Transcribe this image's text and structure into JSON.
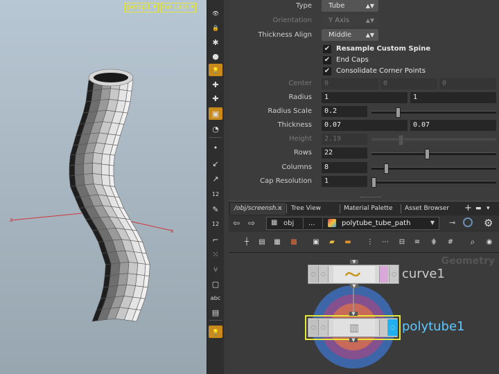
{
  "viewport": {
    "camera_menu": "persp1",
    "cam_menu": "no cam"
  },
  "shelf": {
    "items": [
      {
        "icon": "eye-icon",
        "glyph": "👁",
        "active": false
      },
      {
        "icon": "lock-icon",
        "glyph": "🔒",
        "active": false
      },
      {
        "icon": "snap-icon",
        "glyph": "✱",
        "active": false
      },
      {
        "icon": "sphere-icon",
        "glyph": "●",
        "active": false
      },
      {
        "icon": "light-bulb-icon",
        "glyph": "💡",
        "active": true
      },
      {
        "icon": "add-light-icon",
        "glyph": "✚",
        "active": false
      },
      {
        "icon": "ghost-light-icon",
        "glyph": "✚",
        "active": false
      },
      {
        "icon": "display-icon",
        "glyph": "▣",
        "active": true
      },
      {
        "icon": "visibility-icon",
        "glyph": "◔",
        "active": false
      },
      {
        "icon": "point-icon",
        "glyph": "•",
        "active": false
      },
      {
        "icon": "normal-icon",
        "glyph": "↙",
        "active": false
      },
      {
        "icon": "pick-icon",
        "glyph": "↗",
        "active": false
      },
      {
        "icon": "numbers-12-icon",
        "glyph": "12",
        "active": false
      },
      {
        "icon": "brush-icon",
        "glyph": "✎",
        "active": false
      },
      {
        "icon": "numbers-12b-icon",
        "glyph": "12",
        "active": false
      },
      {
        "icon": "corner-icon",
        "glyph": "⌐",
        "active": false
      },
      {
        "icon": "grid-dots-icon",
        "glyph": "⁙",
        "active": false
      },
      {
        "icon": "branch-icon",
        "glyph": "⑂",
        "active": false
      },
      {
        "icon": "frame-icon",
        "glyph": "▢",
        "active": false
      },
      {
        "icon": "text-abc-icon",
        "glyph": "abc",
        "active": false
      },
      {
        "icon": "image-icon",
        "glyph": "▤",
        "active": false
      },
      {
        "icon": "lamp-icon",
        "glyph": "💡",
        "active": true
      }
    ]
  },
  "params": {
    "type": {
      "label": "Type",
      "value": "Tube"
    },
    "orientation": {
      "label": "Orientation",
      "value": "Y Axis"
    },
    "thickness_align": {
      "label": "Thickness Align",
      "value": "Middle"
    },
    "resample": {
      "label": "Resample Custom Spine",
      "checked": true
    },
    "end_caps": {
      "label": "End Caps",
      "checked": true
    },
    "consolidate": {
      "label": "Consolidate Corner Points",
      "checked": true
    },
    "center": {
      "label": "Center",
      "values": [
        "0",
        "0",
        "0"
      ]
    },
    "radius": {
      "label": "Radius",
      "values": [
        "1",
        "1"
      ]
    },
    "radius_scale": {
      "label": "Radius Scale",
      "value": "0.2",
      "fraction": 0.2
    },
    "thickness": {
      "label": "Thickness",
      "values": [
        "0.07",
        "0.07"
      ]
    },
    "height": {
      "label": "Height",
      "value": "2.19",
      "fraction": 0.22
    },
    "rows": {
      "label": "Rows",
      "value": "22",
      "fraction": 0.44
    },
    "columns": {
      "label": "Columns",
      "value": "8",
      "fraction": 0.1
    },
    "cap_resolution": {
      "label": "Cap Resolution",
      "value": "1",
      "fraction": 0.0
    }
  },
  "tabs": {
    "items": [
      "/obj/screensh...",
      "Tree View",
      "Material Palette",
      "Asset Browser"
    ]
  },
  "path": {
    "root": "obj",
    "ellipsis": "...",
    "node": "polytube_tube_path"
  },
  "network": {
    "context_label": "Geometry",
    "nodes": [
      {
        "name": "curve1",
        "color": "#e8e8e8"
      },
      {
        "name": "polytube1",
        "color": "#5fc8ff"
      }
    ]
  }
}
